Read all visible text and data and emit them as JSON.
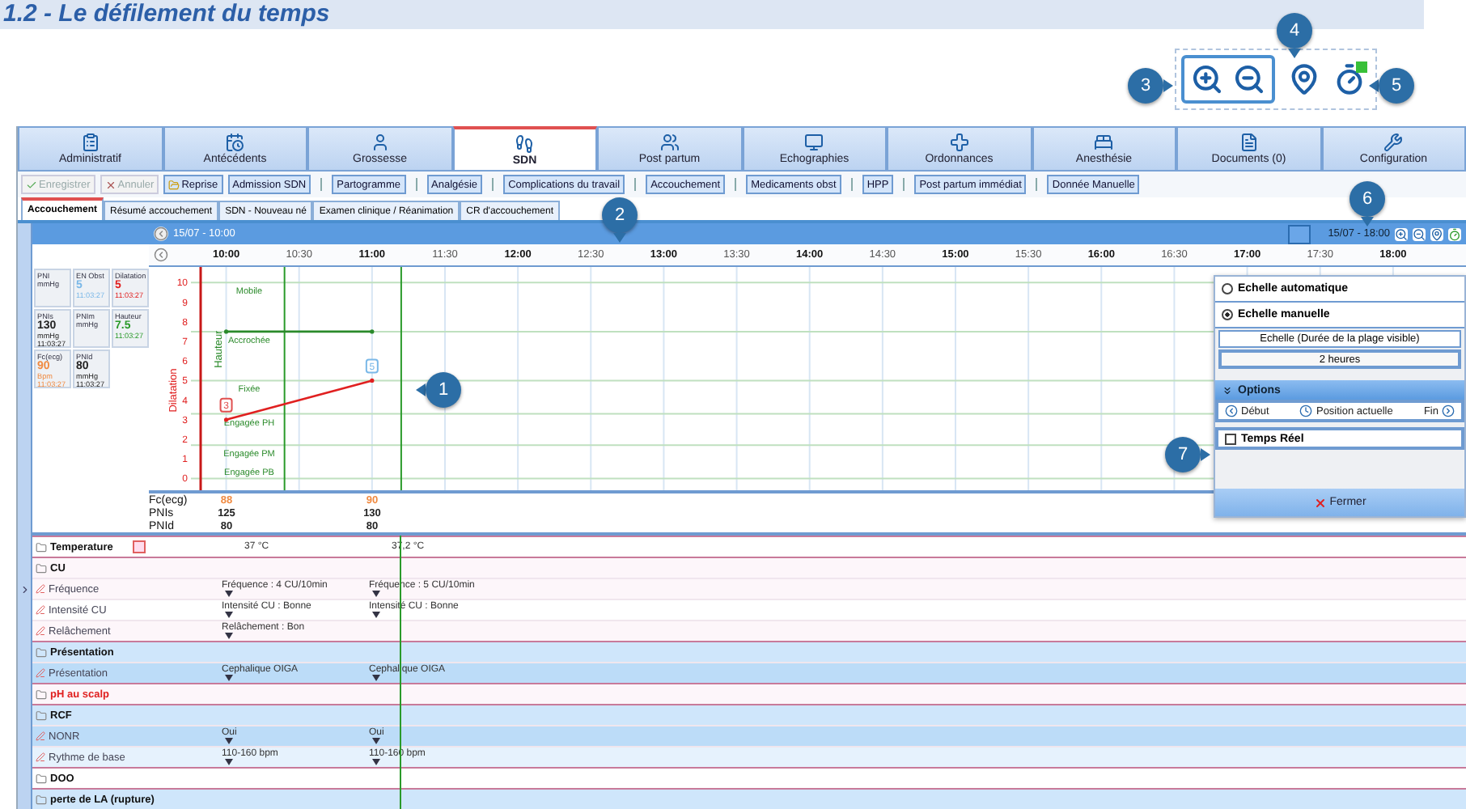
{
  "heading": "1.2 - Le défilement du temps",
  "callouts": [
    "1",
    "2",
    "3",
    "4",
    "5",
    "6",
    "7"
  ],
  "main_tabs": [
    {
      "label": "Administratif",
      "selected": false
    },
    {
      "label": "Antécédents",
      "selected": false
    },
    {
      "label": "Grossesse",
      "selected": false
    },
    {
      "label": "SDN",
      "selected": true
    },
    {
      "label": "Post partum",
      "selected": false
    },
    {
      "label": "Echographies",
      "selected": false
    },
    {
      "label": "Ordonnances",
      "selected": false
    },
    {
      "label": "Anesthésie",
      "selected": false
    },
    {
      "label": "Documents (0)",
      "selected": false
    },
    {
      "label": "Configuration",
      "selected": false
    }
  ],
  "action_groups": [
    [
      {
        "label": "Enregistrer",
        "disabled": true
      },
      {
        "label": "Annuler",
        "disabled": true
      },
      {
        "label": "Reprise",
        "disabled": false
      },
      {
        "label": "Admission SDN",
        "disabled": false
      }
    ],
    [
      {
        "label": "Partogramme",
        "disabled": false
      }
    ],
    [
      {
        "label": "Analgésie",
        "disabled": false
      }
    ],
    [
      {
        "label": "Complications du travail",
        "disabled": false
      }
    ],
    [
      {
        "label": "Accouchement",
        "disabled": false
      }
    ],
    [
      {
        "label": "Medicaments obst",
        "disabled": false
      }
    ],
    [
      {
        "label": "HPP",
        "disabled": false
      }
    ],
    [
      {
        "label": "Post partum immédiat",
        "disabled": false
      }
    ],
    [
      {
        "label": "Donnée Manuelle",
        "disabled": false
      }
    ]
  ],
  "sub_tabs": [
    {
      "label": "Accouchement",
      "selected": true
    },
    {
      "label": "Résumé accouchement",
      "selected": false
    },
    {
      "label": "SDN - Nouveau né",
      "selected": false
    },
    {
      "label": "Examen clinique / Réanimation",
      "selected": false
    },
    {
      "label": "CR d'accouchement",
      "selected": false
    }
  ],
  "timeline": {
    "start": "15/07 - 10:00",
    "end": "15/07 - 18:00"
  },
  "vital_cards": [
    {
      "label": "PNI",
      "unit": "mmHg"
    },
    {
      "label": "EN Obst",
      "value": "5",
      "time": "11:03:27",
      "color": "#7ab8e8"
    },
    {
      "label": "Dilatation",
      "value": "5",
      "time": "11:03:27",
      "color": "#e02020"
    },
    {
      "label": "PNIs",
      "value": "130",
      "unit": "mmHg",
      "time": "11:03:27",
      "color": "#222222"
    },
    {
      "label": "PNIm",
      "unit": "mmHg"
    },
    {
      "label": "Hauteur",
      "value": "7.5",
      "time": "11:03:27",
      "color": "#2a9a2a"
    },
    {
      "label": "Fc(ecg)",
      "value": "90",
      "unit": "Bpm",
      "time": "11:03:27",
      "color": "#f08a40"
    },
    {
      "label": "PNId",
      "value": "80",
      "unit": "mmHg",
      "time": "11:03:27",
      "color": "#222222"
    }
  ],
  "partogram": {
    "chart_data": {
      "type": "line",
      "x": [
        10,
        11
      ],
      "xlim": [
        9.47,
        18.5
      ],
      "ylim": [
        -0.6,
        10.8
      ],
      "xticks": [
        {
          "value": 10,
          "label": "10:00"
        },
        {
          "value": 10.5,
          "label": "10:30"
        },
        {
          "value": 11,
          "label": "11:00"
        },
        {
          "value": 11.5,
          "label": "11:30"
        },
        {
          "value": 12,
          "label": "12:00"
        },
        {
          "value": 12.5,
          "label": "12:30"
        },
        {
          "value": 13,
          "label": "13:00"
        },
        {
          "value": 13.5,
          "label": "13:30"
        },
        {
          "value": 14,
          "label": "14:00"
        },
        {
          "value": 14.5,
          "label": "14:30"
        },
        {
          "value": 15,
          "label": "15:00"
        },
        {
          "value": 15.5,
          "label": "15:30"
        },
        {
          "value": 16,
          "label": "16:00"
        },
        {
          "value": 16.5,
          "label": "16:30"
        },
        {
          "value": 17,
          "label": "17:00"
        },
        {
          "value": 17.5,
          "label": "17:30"
        },
        {
          "value": 18,
          "label": "18:00"
        }
      ],
      "yticks": [
        0,
        1,
        2,
        3,
        4,
        5,
        6,
        7,
        8,
        9,
        10
      ],
      "grid": true,
      "ref_lines": [
        {
          "axis": "x",
          "value": 10.4,
          "color": "#2a9a2a"
        },
        {
          "axis": "x",
          "value": 11.2,
          "color": "#2a9a2a"
        }
      ],
      "series": [
        {
          "name": "Dilatation",
          "color": "#e02020",
          "values": [
            3,
            5
          ]
        },
        {
          "name": "Hauteur",
          "color": "#2a8a2a",
          "values": [
            7.5,
            7.5
          ]
        }
      ],
      "annotations": [
        "Mobile",
        "Accrochée",
        "Fixée",
        "Engagée PH",
        "Engagée PM",
        "Engagée PB",
        {
          "text": "3",
          "x": 10,
          "y": 3
        },
        {
          "text": "5",
          "x": 11,
          "y": 5
        }
      ]
    }
  },
  "vitals_table": [
    {
      "label": "Fc(ecg)",
      "values": [
        "88",
        "90"
      ],
      "color": "#f08a40"
    },
    {
      "label": "PNIs",
      "values": [
        "125",
        "130"
      ],
      "color": "#222222"
    },
    {
      "label": "PNId",
      "values": [
        "80",
        "80"
      ],
      "color": "#222222"
    }
  ],
  "scale_popup": {
    "modes": [
      {
        "label": "Echelle automatique",
        "selected": false
      },
      {
        "label": "Echelle manuelle",
        "selected": true
      }
    ],
    "scale_caption": "Echelle (Durée de la plage visible)",
    "scale_value": "2 heures",
    "options_title": "Options",
    "nav": [
      "Début",
      "Position actuelle",
      "Fin"
    ],
    "realtime": {
      "label": "Temps Réel",
      "checked": false
    },
    "close": "Fermer"
  },
  "rows": [
    {
      "kind": "group",
      "label": "Temperature",
      "color": "#ffffff",
      "alert": false,
      "marked": true,
      "values": [
        "37 °C",
        "37,2 °C"
      ]
    },
    {
      "kind": "group",
      "label": "CU",
      "color": "#fdf6fa",
      "alert": false,
      "marked": false,
      "values": []
    },
    {
      "kind": "item",
      "label": "Fréquence",
      "color": "#fdf6fa",
      "values": [
        "Fréquence : 4 CU/10min",
        "Fréquence : 5 CU/10min"
      ]
    },
    {
      "kind": "item",
      "label": "Intensité CU",
      "color": "#ffffff",
      "values": [
        "Intensité CU : Bonne",
        "Intensité CU : Bonne"
      ]
    },
    {
      "kind": "item",
      "label": "Relâchement",
      "color": "#fdf6fa",
      "values": [
        "Relâchement : Bon"
      ]
    },
    {
      "kind": "group",
      "label": "Présentation",
      "color": "#cfe6fb",
      "alert": false,
      "marked": false,
      "values": []
    },
    {
      "kind": "item",
      "label": "Présentation",
      "color": "#bcdcf8",
      "values": [
        "Cephalique OIGA",
        "Cephalique OIGA"
      ]
    },
    {
      "kind": "group",
      "label": "pH au scalp",
      "color": "#fdf6fa",
      "alert": true,
      "marked": false,
      "values": []
    },
    {
      "kind": "group",
      "label": "RCF",
      "color": "#cfe6fb",
      "alert": false,
      "marked": false,
      "values": []
    },
    {
      "kind": "item",
      "label": "NONR",
      "color": "#bcdcf8",
      "values": [
        "Oui",
        "Oui"
      ]
    },
    {
      "kind": "item",
      "label": "Rythme de base",
      "color": "#e6f2fd",
      "values": [
        "110-160 bpm",
        "110-160 bpm"
      ]
    },
    {
      "kind": "group",
      "label": "DOO",
      "color": "#ffffff",
      "alert": false,
      "marked": false,
      "values": []
    },
    {
      "kind": "group",
      "label": "perte de LA (rupture)",
      "color": "#cfe6fb",
      "alert": false,
      "marked": false,
      "values": []
    }
  ]
}
